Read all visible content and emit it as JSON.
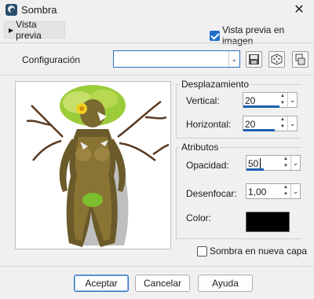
{
  "window": {
    "title": "Sombra",
    "close_glyph": "✕"
  },
  "preview_toggle": {
    "label": "Vista previa",
    "glyph": "▶"
  },
  "live_preview": {
    "label": "Vista previa en imagen",
    "checked": true
  },
  "config": {
    "label": "Configuración",
    "value": ""
  },
  "toolbar": {
    "icons": [
      "save-icon",
      "random-dice-icon",
      "reset-defaults-icon"
    ]
  },
  "offset_group": {
    "title": "Desplazamiento",
    "vertical": {
      "label": "Vertical:",
      "value": "20"
    },
    "horizontal": {
      "label": "Horizontal:",
      "value": "20"
    }
  },
  "attributes_group": {
    "title": "Atributos",
    "opacity": {
      "label": "Opacidad:",
      "value": "50"
    },
    "blur": {
      "label": "Desenfocar:",
      "value": "1,00"
    },
    "color": {
      "label": "Color:",
      "value": "#000000"
    }
  },
  "shadow_new_layer": {
    "label": "Sombra en nueva capa",
    "checked": false
  },
  "buttons": {
    "ok": "Aceptar",
    "cancel": "Cancelar",
    "help": "Ayuda"
  },
  "spin_glyphs": {
    "up": "▲",
    "down": "▼",
    "dropdown": "⌄"
  }
}
